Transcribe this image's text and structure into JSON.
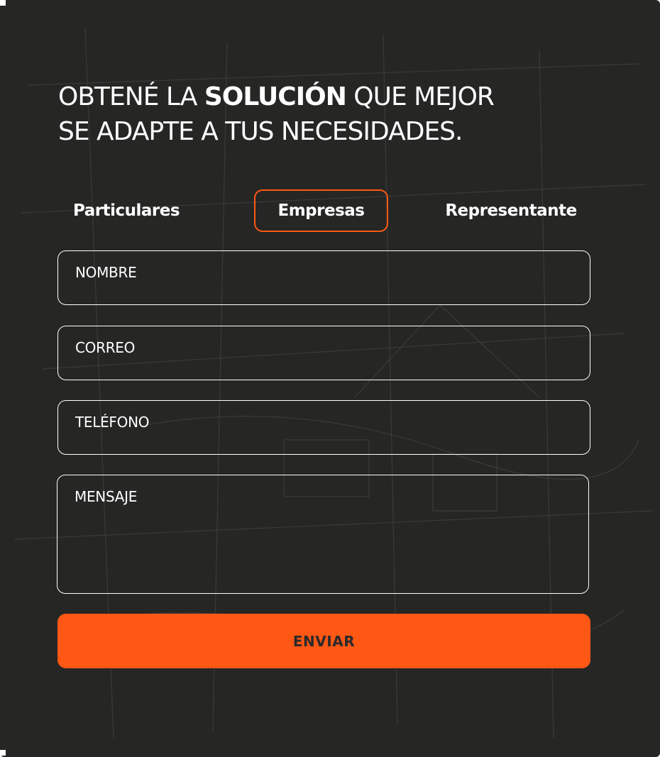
{
  "form": {
    "headline": {
      "line1_before": "OBTENÉ LA",
      "line1_strong": "SOLUCIÓN",
      "line1_after": "QUE MEJOR",
      "line2": "SE ADAPTE A TUS NECESIDADES."
    },
    "tabs": [
      {
        "label": "Particulares",
        "selected": false
      },
      {
        "label": "Empresas",
        "selected": true
      },
      {
        "label": "Representante",
        "selected": false
      }
    ],
    "fields": {
      "nombre": {
        "label": "NOMBRE",
        "value": ""
      },
      "correo": {
        "label": "CORREO",
        "value": ""
      },
      "telefono": {
        "label": "TELÉFONO",
        "value": ""
      },
      "mensaje": {
        "label": "MENSAJE",
        "value": ""
      }
    },
    "submit_label": "ENVIAR"
  },
  "colors": {
    "background": "#262625",
    "accent": "#ff5714",
    "text": "#ffffff",
    "button_text": "#2a2a2a"
  }
}
